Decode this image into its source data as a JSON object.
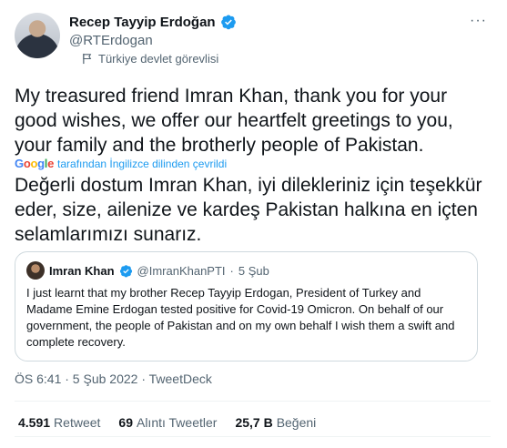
{
  "author": {
    "display_name": "Recep Tayyip Erdoğan",
    "handle": "@RTErdogan",
    "label": "Türkiye devlet görevlisi",
    "avatar_icon": "user-avatar",
    "verified_icon": "verified-badge-icon",
    "label_icon": "flag-icon"
  },
  "more_menu": "···",
  "tweet_text_en": "My treasured friend Imran Khan, thank you for your good wishes, we offer our heartfelt greetings to you, your family and the brotherly people of Pakistan.",
  "translation": {
    "logo": "Google",
    "text": "tarafından İngilizce dilinden çevrildi"
  },
  "tweet_text_tr": "Değerli dostum Imran Khan, iyi dilekleriniz için teşekkür eder, size, ailenize ve kardeş Pakistan halkına en içten selamlarımızı sunarız.",
  "quoted_tweet": {
    "display_name": "Imran Khan",
    "handle": "@ImranKhanPTI",
    "separator": "·",
    "date": "5 Şub",
    "text": "I just learnt that my brother Recep Tayyip Erdogan, President of Turkey and Madame Emine Erdogan tested positive for Covid-19 Omicron. On behalf of our government, the people of Pakistan and on my own behalf I wish them a swift and complete recovery."
  },
  "meta": "ÖS 6:41 · 5 Şub 2022 · TweetDeck",
  "stats": {
    "retweets_num": "4.591",
    "retweets_label": "Retweet",
    "quotes_num": "69",
    "quotes_label": "Alıntı Tweetler",
    "likes_num": "25,7 B",
    "likes_label": "Beğeni"
  },
  "colors": {
    "accent": "#1d9bf0",
    "secondary_text": "#536471",
    "border": "#cfd9de"
  }
}
